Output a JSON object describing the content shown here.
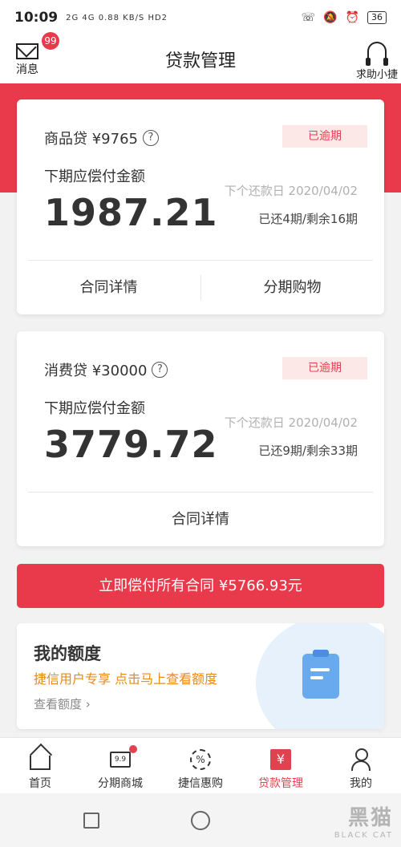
{
  "status_bar": {
    "time": "10:09",
    "network": "2G 4G 0.88 KB/S HD2",
    "battery": "36"
  },
  "header": {
    "title": "贷款管理",
    "messages_label": "消息",
    "messages_badge": "99",
    "help_label": "求助小捷"
  },
  "loans": [
    {
      "name": "商品贷 ¥9765",
      "status": "已逾期",
      "due_label": "下期应偿付金额",
      "amount": "1987.21",
      "next_date": "下个还款日 2020/04/02",
      "periods": "已还4期/剩余16期",
      "actions": [
        "合同详情",
        "分期购物"
      ]
    },
    {
      "name": "消费贷 ¥30000",
      "status": "已逾期",
      "due_label": "下期应偿付金额",
      "amount": "3779.72",
      "next_date": "下个还款日 2020/04/02",
      "periods": "已还9期/剩余33期",
      "actions": [
        "合同详情"
      ]
    }
  ],
  "pay_all_label": "立即偿付所有合同 ¥5766.93元",
  "quota": {
    "title": "我的额度",
    "subtitle": "捷信用户专享 点击马上查看额度",
    "link": "查看额度 ›"
  },
  "tabs": [
    {
      "label": "首页",
      "icon": "home-icon"
    },
    {
      "label": "分期商城",
      "icon": "cart-icon"
    },
    {
      "label": "捷信惠购",
      "icon": "discount-icon"
    },
    {
      "label": "贷款管理",
      "icon": "yuan-icon",
      "active": true
    },
    {
      "label": "我的",
      "icon": "user-icon"
    }
  ],
  "watermark": {
    "main": "黑猫",
    "sub": "BLACK CAT"
  },
  "colors": {
    "brand_red": "#e83a4a",
    "overdue_bg": "#fde8e8",
    "quota_accent": "#e88a1a"
  }
}
